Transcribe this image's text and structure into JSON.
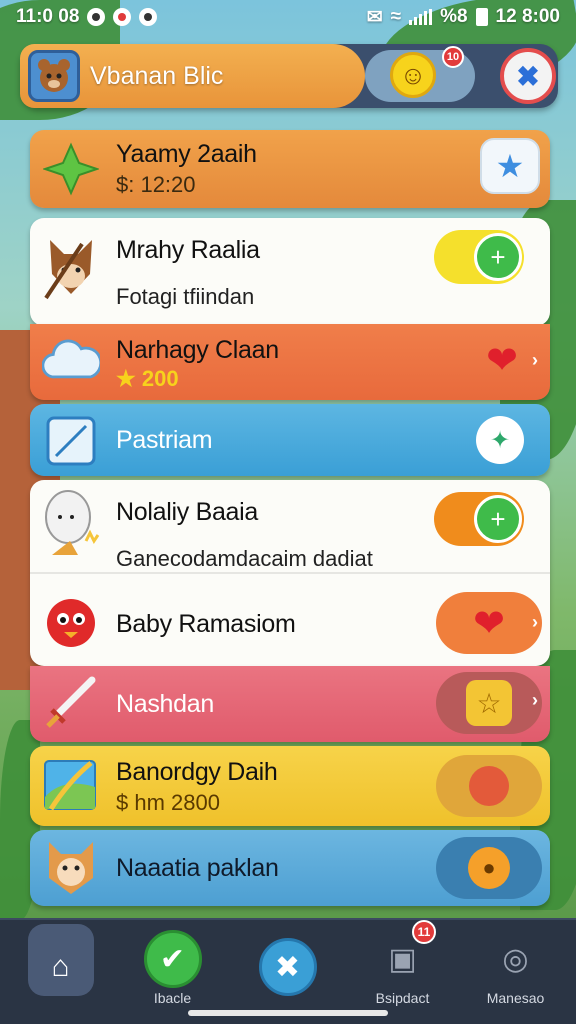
{
  "status_bar": {
    "time_left": "11:0 08",
    "battery_text": "%8",
    "time_right": "12 8:00"
  },
  "header": {
    "title": "Vbanan Blic",
    "notification_count": "10"
  },
  "rows": [
    {
      "title": "Yaamy 2aaih",
      "sub": "$: 12:20"
    },
    {
      "title": "Mrahy Raalia",
      "sub": "Fotagi tfiindan"
    },
    {
      "title": "Narhagy Claan",
      "sub": "200"
    },
    {
      "title": "Pastriam"
    },
    {
      "title": "Nolaliy Baaia",
      "sub": "Ganecodamdacaim dadiat"
    },
    {
      "title": "Baby Ramasiom"
    },
    {
      "title": "Nashdan"
    },
    {
      "title": "Banordgy Daih",
      "sub": "$ hm 2800"
    },
    {
      "title": "Naaatia paklan"
    }
  ],
  "nav": {
    "items": [
      {
        "label": ""
      },
      {
        "label": "Ibacle"
      },
      {
        "label": ""
      },
      {
        "label": "Bsipdact",
        "badge": "11"
      },
      {
        "label": "Manesao"
      }
    ]
  },
  "colors": {
    "accent_orange": "#e8943a",
    "toggle_green": "#3fbb4a",
    "heart_red": "#e0202c",
    "nav_bg": "#2a3444"
  }
}
